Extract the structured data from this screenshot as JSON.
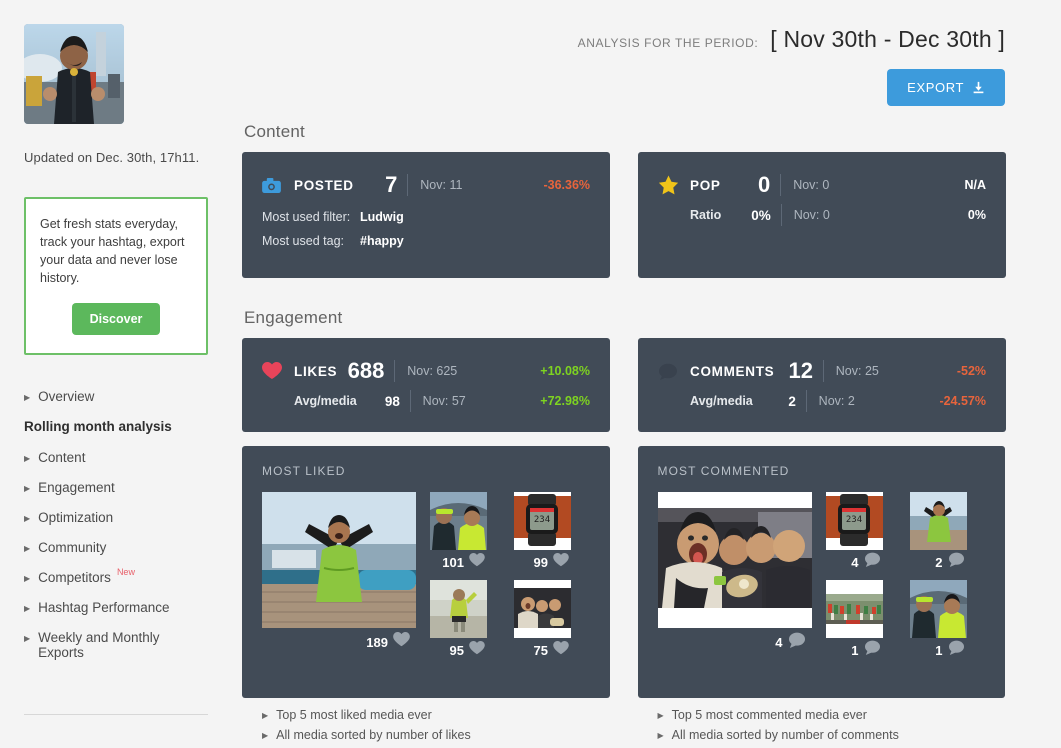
{
  "sidebar": {
    "avatar_alt": "profile-photo",
    "updated_text": "Updated on Dec. 30th, 17h11.",
    "promo": {
      "text": "Get fresh stats everyday, track your hashtag, export your data and never lose history.",
      "button_label": "Discover",
      "border_color": "#6dc067",
      "button_color": "#5cb85c"
    },
    "nav": [
      {
        "label": "Overview",
        "type": "link"
      },
      {
        "label": "Rolling month analysis",
        "type": "heading"
      },
      {
        "label": "Content",
        "type": "link"
      },
      {
        "label": "Engagement",
        "type": "link"
      },
      {
        "label": "Optimization",
        "type": "link"
      },
      {
        "label": "Community",
        "type": "link"
      },
      {
        "label": "Competitors",
        "type": "link",
        "badge": "New"
      },
      {
        "label": "Hashtag Performance",
        "type": "link"
      },
      {
        "label": "Weekly and Monthly Exports",
        "type": "link"
      }
    ]
  },
  "header": {
    "period_label": "ANALYSIS FOR THE PERIOD:",
    "period_value": "[ Nov 30th - Dec 30th ]",
    "export_label": "EXPORT",
    "export_icon": "download-icon",
    "export_color": "#3d9bdc"
  },
  "sections": {
    "content_title": "Content",
    "engagement_title": "Engagement"
  },
  "cards": {
    "posted": {
      "icon": "camera-icon",
      "icon_color": "#3d9bdc",
      "name": "POSTED",
      "value": "7",
      "previous": "Nov: 11",
      "delta": "-36.36%",
      "delta_dir": "down",
      "rows": [
        {
          "key": "Most used filter:",
          "value": "Ludwig"
        },
        {
          "key": "Most used tag:",
          "value": "#happy"
        }
      ]
    },
    "pop": {
      "icon": "star-icon",
      "icon_color": "#f0c419",
      "name": "POP",
      "value": "0",
      "previous": "Nov: 0",
      "delta": "N/A",
      "delta_dir": "flat",
      "sub_label": "Ratio",
      "sub_value": "0%",
      "sub_previous": "Nov: 0",
      "sub_delta": "0%",
      "sub_delta_dir": "flat"
    },
    "likes": {
      "icon": "heart-icon",
      "icon_color": "#e8445a",
      "name": "LIKES",
      "value": "688",
      "previous": "Nov: 625",
      "delta": "+10.08%",
      "delta_dir": "up",
      "sub_label": "Avg/media",
      "sub_value": "98",
      "sub_previous": "Nov: 57",
      "sub_delta": "+72.98%",
      "sub_delta_dir": "up"
    },
    "comments": {
      "icon": "comment-icon",
      "icon_color": "#39424e",
      "name": "COMMENTS",
      "value": "12",
      "previous": "Nov: 25",
      "delta": "-52%",
      "delta_dir": "down",
      "sub_label": "Avg/media",
      "sub_value": "2",
      "sub_previous": "Nov: 2",
      "sub_delta": "-24.57%",
      "sub_delta_dir": "down"
    }
  },
  "most_liked": {
    "title": "MOST LIKED",
    "count_icon": "heart-icon",
    "hero": {
      "count": "189",
      "alt": "athlete-arms-raised-photo"
    },
    "thumbs": [
      {
        "count": "101",
        "alt": "two-runners-selfie-photo"
      },
      {
        "count": "99",
        "alt": "smartwatch-photo"
      },
      {
        "count": "95",
        "alt": "runner-standing-photo"
      },
      {
        "count": "75",
        "alt": "group-in-car-photo"
      }
    ],
    "links": [
      "Top 5 most liked media ever",
      "All media sorted by number of likes"
    ]
  },
  "most_commented": {
    "title": "MOST COMMENTED",
    "count_icon": "comment-icon",
    "hero": {
      "count": "4",
      "alt": "group-in-car-photo"
    },
    "thumbs": [
      {
        "count": "4",
        "alt": "smartwatch-photo"
      },
      {
        "count": "2",
        "alt": "athlete-arms-raised-photo"
      },
      {
        "count": "1",
        "alt": "race-crowd-photo"
      },
      {
        "count": "1",
        "alt": "two-runners-selfie-photo"
      }
    ],
    "links": [
      "Top 5 most commented media ever",
      "All media sorted by number of comments"
    ]
  }
}
